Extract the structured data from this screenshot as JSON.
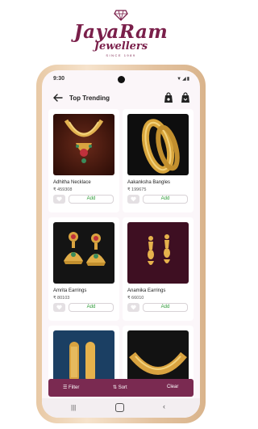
{
  "brand": {
    "name": "JayaRam",
    "subtitle": "Jewellers",
    "since": "SINCE 1989",
    "color": "#7a1f4a"
  },
  "status": {
    "time": "9:30"
  },
  "header": {
    "title": "Top Trending"
  },
  "products": [
    {
      "name": "Adhitha Necklace",
      "price": "₹ 459308",
      "add_label": "Add"
    },
    {
      "name": "Aakanksha Bangles",
      "price": "₹ 199675",
      "add_label": "Add"
    },
    {
      "name": "Amrita Earrings",
      "price": "₹ 80103",
      "add_label": "Add"
    },
    {
      "name": "Anamika Earrings",
      "price": "₹ 66010",
      "add_label": "Add"
    },
    {
      "name": "",
      "price": "",
      "add_label": ""
    },
    {
      "name": "",
      "price": "",
      "add_label": ""
    }
  ],
  "bottom_bar": {
    "filter_label": "Filter",
    "sort_label": "Sort",
    "clear_label": "Clear",
    "color": "#7a2a51"
  },
  "colors": {
    "add_text": "#2c9a36",
    "screen_bg": "#fbf6f9"
  }
}
